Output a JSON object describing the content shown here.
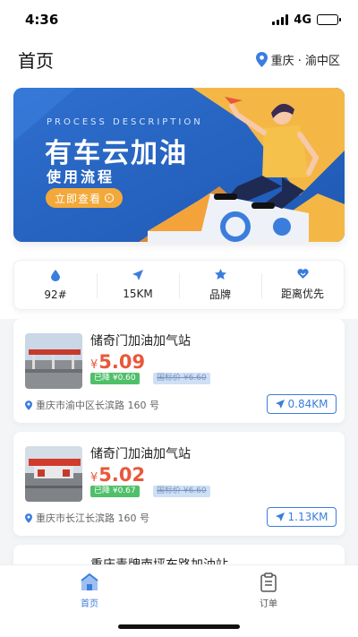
{
  "status_bar": {
    "time": "4:36",
    "network": "4G"
  },
  "header": {
    "title": "首页",
    "location": "重庆 · 渝中区"
  },
  "banner": {
    "subtitle": "PROCESS DESCRIPTION",
    "title": "有车云加油",
    "title2": "使用流程",
    "button": "立即查看"
  },
  "filters": [
    {
      "icon": "fuel-drop-icon",
      "label": "92#"
    },
    {
      "icon": "navigation-arrow-icon",
      "label": "15KM"
    },
    {
      "icon": "star-icon",
      "label": "品牌"
    },
    {
      "icon": "heart-icon",
      "label": "距离优先"
    }
  ],
  "stations": [
    {
      "name": "储奇门加油加气站",
      "currency": "¥",
      "price": "5.09",
      "discount": "已降 ¥0.60",
      "list_price": "国标价 ¥6.60",
      "address": "重庆市渝中区长滨路 160 号",
      "distance": "0.84KM"
    },
    {
      "name": "储奇门加油加气站",
      "currency": "¥",
      "price": "5.02",
      "discount": "已降 ¥0.67",
      "list_price": "国标价 ¥6.60",
      "address": "重庆市长江长滨路 160 号",
      "distance": "1.13KM"
    },
    {
      "name": "重庆青牌南坪东路加油站"
    }
  ],
  "tabbar": {
    "home": "首页",
    "orders": "订单"
  },
  "colors": {
    "accent": "#3b7ddd",
    "price": "#e8583a",
    "discount_badge": "#4fbf6a",
    "banner_orange": "#f3a93a"
  }
}
